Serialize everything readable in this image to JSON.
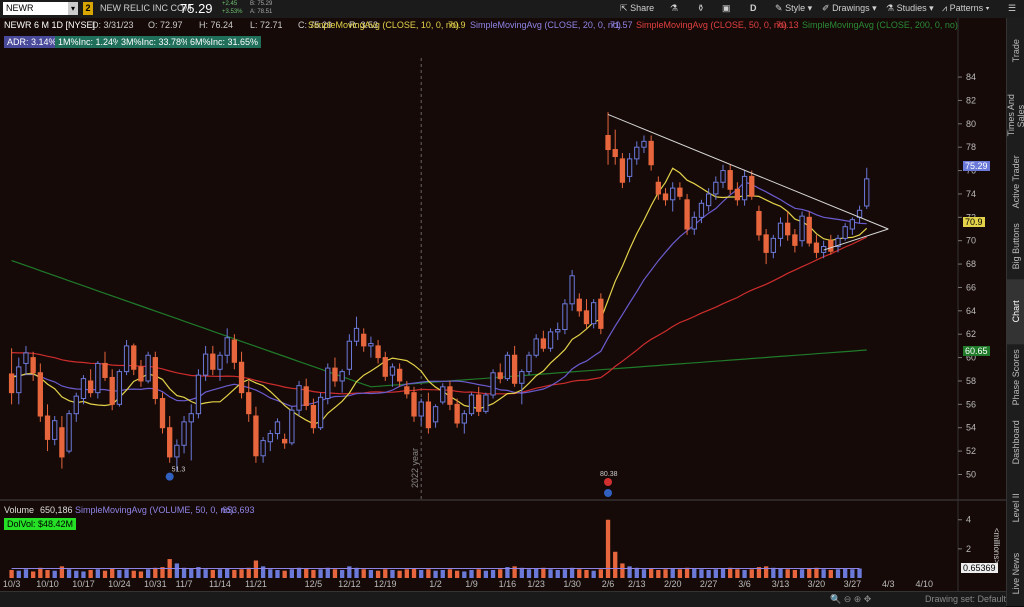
{
  "toolbar": {
    "symbol": "NEWR",
    "link_badge": "2",
    "company": "NEW RELIC INC COM",
    "last": "75.29",
    "change_top": "+2.45",
    "change_bottom": "+3.53%",
    "bid": "B: 75.29",
    "ask": "A: 78.51",
    "share_label": "Share",
    "style_label": "Style",
    "drawings_label": "Drawings",
    "studies_label": "Studies",
    "patterns_label": "Patterns",
    "d_label": "D"
  },
  "header": {
    "title": "NEWR 6 M 1D [NYSE]",
    "date": "D: 3/31/23",
    "open": "O: 72.97",
    "high": "H: 76.24",
    "low": "L: 72.71",
    "close": "C: 75.29",
    "range": "R: 3.53",
    "sma10_label": "SimpleMovingAvg (CLOSE, 10, 0, no)",
    "sma10_value": "70.9",
    "sma20_label": "SimpleMovingAvg (CLOSE, 20, 0, no)",
    "sma20_value": "71.57",
    "sma50_label": "SimpleMovingAvg (CLOSE, 50, 0, no)",
    "sma50_value": "70.13",
    "sma200_label": "SimpleMovingAvg (CLOSE, 200, 0, no)",
    "sma200_value": "60.65"
  },
  "stats": {
    "adr": "ADR: 3.14%",
    "m1": "1M%Inc: 1.24%",
    "m3": "3M%Inc: 33.78%",
    "m6": "6M%Inc: 31.65%"
  },
  "annotations": {
    "year": "2022 year",
    "low_label": "51.3",
    "high_label": "80.38"
  },
  "volume_header": {
    "label": "Volume",
    "value": "650,186",
    "sma_label": "SimpleMovingAvg (VOLUME, 50, 0, no)",
    "sma_value": "653,693",
    "dolvol": "DolVol: $48.42M",
    "last_vol": "0.65369",
    "units": "<millions>"
  },
  "sidebar": [
    "Trade",
    "Times And Sales",
    "Active Trader",
    "Big Buttons",
    "Chart",
    "Phase Scores",
    "Dashboard",
    "Level II",
    "Live News"
  ],
  "bottombar": {
    "drawing_set": "Drawing set: Default"
  },
  "colors": {
    "bg": "#150a08",
    "up": "#6b79d9",
    "down": "#e8663d",
    "sma10": "#e3d24a",
    "sma20": "#6a5ccf",
    "sma50": "#cf2d2d",
    "sma200": "#1f7a2a",
    "trend": "#d8d8d8"
  },
  "chart_data": {
    "type": "candlestick",
    "title": "NEWR 6 M 1D [NYSE]",
    "ylim": [
      48.5,
      87
    ],
    "y_ticks": [
      50,
      52,
      54,
      56,
      58,
      60,
      62,
      64,
      66,
      68,
      70,
      72,
      74,
      76,
      78,
      80,
      82,
      84
    ],
    "x_tick_labels": [
      "10/3",
      "10/10",
      "10/17",
      "10/24",
      "10/31",
      "11/7",
      "11/14",
      "11/21",
      "12/5",
      "12/12",
      "12/19",
      "1/2",
      "1/9",
      "1/16",
      "1/23",
      "1/30",
      "2/6",
      "2/13",
      "2/20",
      "2/27",
      "3/6",
      "3/13",
      "3/20",
      "3/27",
      "4/3",
      "4/10"
    ],
    "x_tick_bar_index": [
      0,
      5,
      10,
      15,
      20,
      24,
      29,
      34,
      42,
      47,
      52,
      59,
      64,
      69,
      73,
      78,
      83,
      87,
      92,
      97,
      102,
      107,
      112,
      117,
      122,
      127
    ],
    "ohlc": [
      [
        58.6,
        60.8,
        56.0,
        57.0
      ],
      [
        57.0,
        60.0,
        56.0,
        59.2
      ],
      [
        59.5,
        61.0,
        58.5,
        60.4
      ],
      [
        60.0,
        60.5,
        58.0,
        58.7
      ],
      [
        58.7,
        59.5,
        54.5,
        55.0
      ],
      [
        55.0,
        56.0,
        52.0,
        53.0
      ],
      [
        53.0,
        55.0,
        52.5,
        54.6
      ],
      [
        54.0,
        55.0,
        50.5,
        51.5
      ],
      [
        52.0,
        55.5,
        51.8,
        55.2
      ],
      [
        55.2,
        57.0,
        54.5,
        56.7
      ],
      [
        56.5,
        58.5,
        56.0,
        58.2
      ],
      [
        58.0,
        59.0,
        56.6,
        57.0
      ],
      [
        57.0,
        59.7,
        56.5,
        59.5
      ],
      [
        59.5,
        60.5,
        58.0,
        58.3
      ],
      [
        58.3,
        59.0,
        55.5,
        56.0
      ],
      [
        56.0,
        59.0,
        55.8,
        58.8
      ],
      [
        58.8,
        61.5,
        58.5,
        61.0
      ],
      [
        61.0,
        61.2,
        58.5,
        59.0
      ],
      [
        59.2,
        59.8,
        57.5,
        58.0
      ],
      [
        58.0,
        60.5,
        57.8,
        60.2
      ],
      [
        60.0,
        60.5,
        56.0,
        56.5
      ],
      [
        56.5,
        57.0,
        53.5,
        54.0
      ],
      [
        54.0,
        55.0,
        51.0,
        51.5
      ],
      [
        51.5,
        53.0,
        50.3,
        52.5
      ],
      [
        52.5,
        55.0,
        51.8,
        54.5
      ],
      [
        54.5,
        56.0,
        51.2,
        55.2
      ],
      [
        55.2,
        59.0,
        54.8,
        58.5
      ],
      [
        58.5,
        61.0,
        58.0,
        60.3
      ],
      [
        60.3,
        61.0,
        58.5,
        59.0
      ],
      [
        59.0,
        60.5,
        58.0,
        60.2
      ],
      [
        60.2,
        62.5,
        59.5,
        61.7
      ],
      [
        61.5,
        62.0,
        59.0,
        59.6
      ],
      [
        59.6,
        60.5,
        56.5,
        57.0
      ],
      [
        57.0,
        58.0,
        54.5,
        55.2
      ],
      [
        55.0,
        55.8,
        51.0,
        51.6
      ],
      [
        51.6,
        53.2,
        51.0,
        52.9
      ],
      [
        52.8,
        53.8,
        52.0,
        53.5
      ],
      [
        53.5,
        54.8,
        53.0,
        54.5
      ],
      [
        53.0,
        53.5,
        52.2,
        52.7
      ],
      [
        52.7,
        55.8,
        52.5,
        55.5
      ],
      [
        55.5,
        58.0,
        55.0,
        57.6
      ],
      [
        57.5,
        58.2,
        55.5,
        55.9
      ],
      [
        55.9,
        56.5,
        53.5,
        54.0
      ],
      [
        54.0,
        57.0,
        53.8,
        56.6
      ],
      [
        56.5,
        59.5,
        56.0,
        59.1
      ],
      [
        59.1,
        60.0,
        57.5,
        58.0
      ],
      [
        58.0,
        59.0,
        57.0,
        58.8
      ],
      [
        59.0,
        62.0,
        58.5,
        61.4
      ],
      [
        61.4,
        63.5,
        61.0,
        62.5
      ],
      [
        62.0,
        62.5,
        60.5,
        61.0
      ],
      [
        61.0,
        61.8,
        60.0,
        61.2
      ],
      [
        61.0,
        61.5,
        59.5,
        60.0
      ],
      [
        60.0,
        60.5,
        58.0,
        58.4
      ],
      [
        58.5,
        59.5,
        57.5,
        59.2
      ],
      [
        59.0,
        59.5,
        57.5,
        58.0
      ],
      [
        57.5,
        58.0,
        56.5,
        56.9
      ],
      [
        57.0,
        57.5,
        54.5,
        55.0
      ],
      [
        55.0,
        56.5,
        54.2,
        56.2
      ],
      [
        56.2,
        57.0,
        53.5,
        54.0
      ],
      [
        54.5,
        56.0,
        54.0,
        55.8
      ],
      [
        56.2,
        57.8,
        56.0,
        57.5
      ],
      [
        57.5,
        58.0,
        55.5,
        56.0
      ],
      [
        56.0,
        56.5,
        54.0,
        54.4
      ],
      [
        54.4,
        55.5,
        53.5,
        55.2
      ],
      [
        55.2,
        57.0,
        55.0,
        56.8
      ],
      [
        56.8,
        57.5,
        55.0,
        55.4
      ],
      [
        55.4,
        57.0,
        55.2,
        56.8
      ],
      [
        56.8,
        59.0,
        56.5,
        58.7
      ],
      [
        58.7,
        59.5,
        57.8,
        58.2
      ],
      [
        58.2,
        60.5,
        58.0,
        60.2
      ],
      [
        60.2,
        61.0,
        57.5,
        57.8
      ],
      [
        57.8,
        59.0,
        56.0,
        58.8
      ],
      [
        58.8,
        60.5,
        58.5,
        60.2
      ],
      [
        60.2,
        62.0,
        60.0,
        61.6
      ],
      [
        61.6,
        62.3,
        60.5,
        60.8
      ],
      [
        60.8,
        62.5,
        60.5,
        62.2
      ],
      [
        62.2,
        63.0,
        61.5,
        62.4
      ],
      [
        62.4,
        65.0,
        62.0,
        64.6
      ],
      [
        64.6,
        67.5,
        64.0,
        67.0
      ],
      [
        65.0,
        65.5,
        63.5,
        64.0
      ],
      [
        64.0,
        65.0,
        62.5,
        62.9
      ],
      [
        62.9,
        65.0,
        62.5,
        64.7
      ],
      [
        65.0,
        65.5,
        62.0,
        62.5
      ],
      [
        79.0,
        81.0,
        76.5,
        77.8
      ],
      [
        77.8,
        79.5,
        76.5,
        77.2
      ],
      [
        77.0,
        77.5,
        74.5,
        75.0
      ],
      [
        75.5,
        77.5,
        75.0,
        77.0
      ],
      [
        77.0,
        78.5,
        76.5,
        78.0
      ],
      [
        78.0,
        79.0,
        77.5,
        78.5
      ],
      [
        78.5,
        79.0,
        76.0,
        76.5
      ],
      [
        75.0,
        75.5,
        73.5,
        74.0
      ],
      [
        74.0,
        74.5,
        73.0,
        73.5
      ],
      [
        73.5,
        75.0,
        72.5,
        74.5
      ],
      [
        74.5,
        75.0,
        73.5,
        73.8
      ],
      [
        73.5,
        74.0,
        70.5,
        71.0
      ],
      [
        71.0,
        72.5,
        70.5,
        72.0
      ],
      [
        72.0,
        73.5,
        71.5,
        73.2
      ],
      [
        73.0,
        74.5,
        72.5,
        74.0
      ],
      [
        74.0,
        75.5,
        73.5,
        75.0
      ],
      [
        75.0,
        76.5,
        74.5,
        76.0
      ],
      [
        76.0,
        76.5,
        74.0,
        74.4
      ],
      [
        74.4,
        75.0,
        73.0,
        73.5
      ],
      [
        73.5,
        76.0,
        73.0,
        75.5
      ],
      [
        75.5,
        76.0,
        73.5,
        73.8
      ],
      [
        72.5,
        73.0,
        70.0,
        70.5
      ],
      [
        70.5,
        71.0,
        68.0,
        69.0
      ],
      [
        69.0,
        70.5,
        68.5,
        70.2
      ],
      [
        70.2,
        72.0,
        69.5,
        71.5
      ],
      [
        71.5,
        72.5,
        70.0,
        70.5
      ],
      [
        70.5,
        71.0,
        69.0,
        69.6
      ],
      [
        70.0,
        72.5,
        69.5,
        72.1
      ],
      [
        72.0,
        72.5,
        69.5,
        69.8
      ],
      [
        69.8,
        70.5,
        68.5,
        69.0
      ],
      [
        69.0,
        70.0,
        68.5,
        69.5
      ],
      [
        70.0,
        70.5,
        68.8,
        69.1
      ],
      [
        69.5,
        70.5,
        69.0,
        70.2
      ],
      [
        70.2,
        71.5,
        70.0,
        71.2
      ],
      [
        71.0,
        72.0,
        70.5,
        71.8
      ],
      [
        72.0,
        73.0,
        71.5,
        72.6
      ],
      [
        72.97,
        76.24,
        72.71,
        75.29
      ]
    ],
    "volume_millions": [
      0.55,
      0.5,
      0.6,
      0.45,
      0.7,
      0.55,
      0.5,
      0.8,
      0.6,
      0.5,
      0.45,
      0.55,
      0.6,
      0.5,
      0.65,
      0.55,
      0.6,
      0.5,
      0.45,
      0.6,
      0.7,
      0.75,
      1.3,
      1.0,
      0.7,
      0.65,
      0.75,
      0.6,
      0.55,
      0.6,
      0.65,
      0.55,
      0.6,
      0.7,
      1.2,
      0.8,
      0.6,
      0.55,
      0.5,
      0.6,
      0.7,
      0.65,
      0.55,
      0.6,
      0.7,
      0.6,
      0.55,
      0.8,
      0.7,
      0.6,
      0.55,
      0.5,
      0.6,
      0.55,
      0.5,
      0.6,
      0.65,
      0.55,
      0.6,
      0.5,
      0.55,
      0.6,
      0.5,
      0.45,
      0.55,
      0.6,
      0.5,
      0.55,
      0.6,
      0.75,
      0.8,
      0.7,
      0.6,
      0.65,
      0.7,
      0.6,
      0.55,
      0.6,
      0.7,
      0.6,
      0.55,
      0.5,
      0.6,
      4.0,
      1.8,
      1.0,
      0.8,
      0.7,
      0.6,
      0.65,
      0.55,
      0.6,
      0.65,
      0.6,
      0.7,
      0.65,
      0.6,
      0.55,
      0.6,
      0.65,
      0.7,
      0.6,
      0.55,
      0.6,
      0.75,
      0.8,
      0.7,
      0.65,
      0.6,
      0.55,
      0.6,
      0.65,
      0.7,
      0.6,
      0.55,
      0.6,
      0.65,
      0.6,
      0.65
    ],
    "sma200_endpoints": [
      [
        0,
        68.3
      ],
      [
        119,
        60.65
      ]
    ],
    "trendline": [
      [
        83,
        80.8
      ],
      [
        122,
        71.0
      ]
    ]
  }
}
